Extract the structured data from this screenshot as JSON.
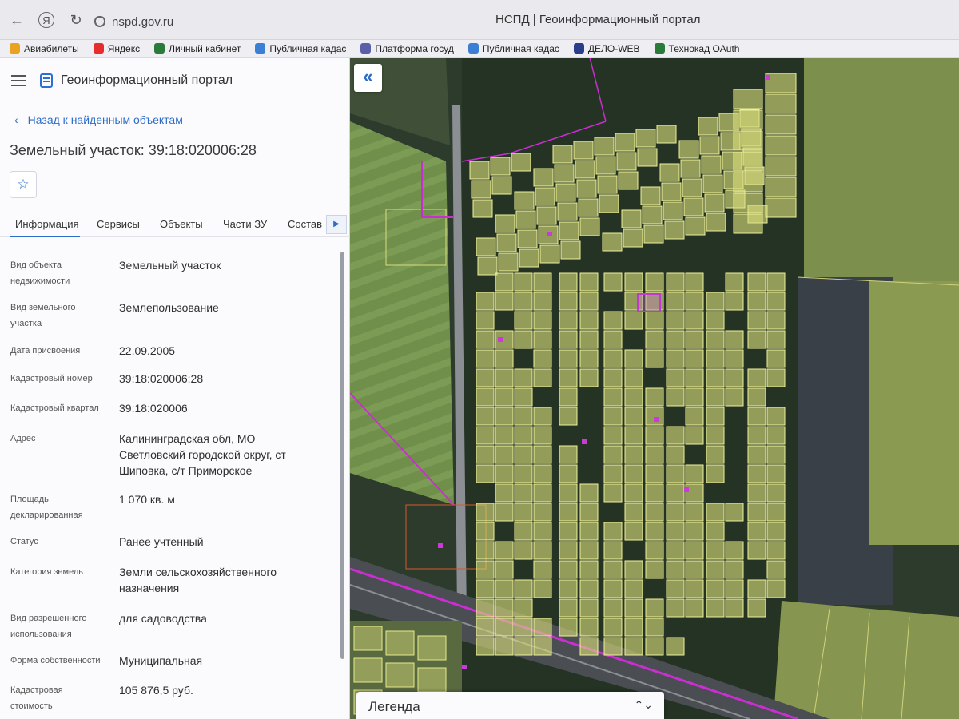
{
  "browser": {
    "url": "nspd.gov.ru",
    "title": "НСПД | Геоинформационный портал",
    "bookmarks": [
      {
        "label": "Авиабилеты",
        "icon": "plane-icon",
        "color": "#e8a320"
      },
      {
        "label": "Яндекс",
        "icon": "yandex-icon",
        "color": "#e62d2d"
      },
      {
        "label": "Личный кабинет",
        "icon": "m-logo-icon",
        "color": "#2a7a3a"
      },
      {
        "label": "Публичная кадас",
        "icon": "globe-icon",
        "color": "#3b7fd4"
      },
      {
        "label": "Платформа госуд",
        "icon": "emblem-icon",
        "color": "#5a5fa8"
      },
      {
        "label": "Публичная кадас",
        "icon": "globe-icon",
        "color": "#3b7fd4"
      },
      {
        "label": "ДЕЛО-WEB",
        "icon": "delo-icon",
        "color": "#2a3f8a"
      },
      {
        "label": "Технокад OAuth",
        "icon": "m-logo-icon",
        "color": "#2a7a3a"
      }
    ]
  },
  "portal": {
    "name": "Геоинформационный портал",
    "back_label": "Назад к найденным объектам",
    "object_title": "Земельный участок: 39:18:020006:28"
  },
  "tabs": [
    {
      "label": "Информация",
      "active": true
    },
    {
      "label": "Сервисы"
    },
    {
      "label": "Объекты"
    },
    {
      "label": "Части ЗУ"
    },
    {
      "label": "Состав"
    }
  ],
  "info": [
    {
      "key": "Вид объекта недвижимости",
      "value": "Земельный участок"
    },
    {
      "key": "Вид земельного участка",
      "value": "Землепользование"
    },
    {
      "key": "Дата присвоения",
      "value": "22.09.2005"
    },
    {
      "key": "Кадастровый номер",
      "value": "39:18:020006:28"
    },
    {
      "key": "Кадастровый квартал",
      "value": "39:18:020006"
    },
    {
      "key": "Адрес",
      "value": "Калининградская обл, МО Светловский городской округ, ст Шиповка, с/т Приморское"
    },
    {
      "key": "Площадь декларированная",
      "value": "1 070 кв. м"
    },
    {
      "key": "Статус",
      "value": "Ранее учтенный"
    },
    {
      "key": "Категория земель",
      "value": "Земли сельскохозяйственного назначения"
    },
    {
      "key": "Вид разрешенного использования",
      "value": "для садоводства"
    },
    {
      "key": "Форма собственности",
      "value": "Муниципальная"
    },
    {
      "key": "Кадастровая стоимость",
      "value": "105 876,5 руб."
    }
  ],
  "map": {
    "legend_label": "Легенда",
    "parcel_fill": "#d9dd7a",
    "parcel_stroke": "#e4e88a",
    "selected_stroke": "#c03ad0",
    "boundary_color": "#d43cd6"
  }
}
